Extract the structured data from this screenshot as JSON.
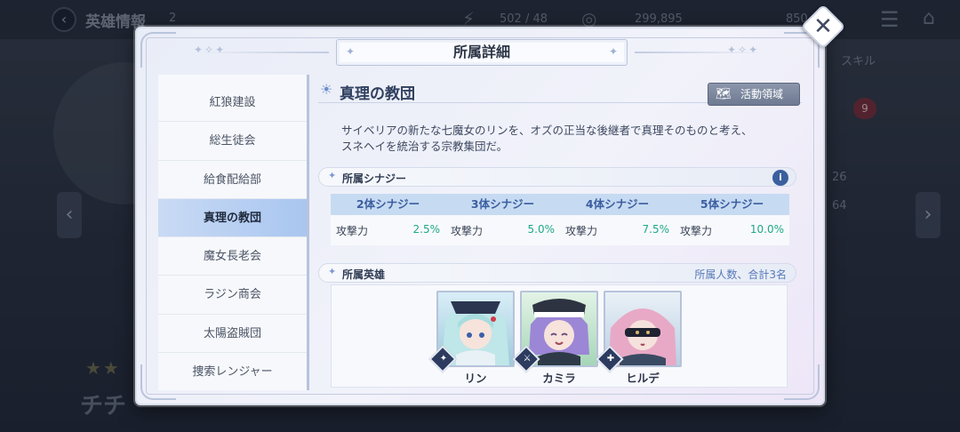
{
  "background": {
    "title": "英雄情報",
    "title_badge": "2",
    "stat_stamina": "502 / 48",
    "stat_gold": "299,895",
    "stat_gems": "850",
    "tab_skill": "スキル",
    "badge_count": "9",
    "side_value_1": "26",
    "side_value_2": "64",
    "hero_name": "チチ"
  },
  "modal": {
    "title": "所属詳細",
    "close_label": "✕"
  },
  "sidebar": {
    "items": [
      {
        "label": "紅狼建設"
      },
      {
        "label": "総生徒会"
      },
      {
        "label": "給食配給部"
      },
      {
        "label": "真理の教団"
      },
      {
        "label": "魔女長老会"
      },
      {
        "label": "ラジン商会"
      },
      {
        "label": "太陽盗賊団"
      },
      {
        "label": "捜索レンジャー"
      }
    ],
    "active_index": 3
  },
  "faction": {
    "name": "真理の教団",
    "area_button_label": "活動領域",
    "description_line1": "サイベリアの新たな七魔女のリンを、オズの正当な後継者で真理そのものと考え、",
    "description_line2": "スネヘイを統治する宗教集団だ。"
  },
  "synergy": {
    "section_label": "所属シナジー",
    "info_label": "i",
    "tiers": [
      {
        "header": "2体シナジー",
        "stat": "攻撃力",
        "value": "2.5%"
      },
      {
        "header": "3体シナジー",
        "stat": "攻撃力",
        "value": "5.0%"
      },
      {
        "header": "4体シナジー",
        "stat": "攻撃力",
        "value": "7.5%"
      },
      {
        "header": "5体シナジー",
        "stat": "攻撃力",
        "value": "10.0%"
      }
    ]
  },
  "heroes": {
    "section_label": "所属英雄",
    "count_text": "所属人数、合計3名",
    "list": [
      {
        "name": "リン"
      },
      {
        "name": "カミラ"
      },
      {
        "name": "ヒルデ"
      }
    ]
  },
  "colors": {
    "accent_blue": "#3c5ea0",
    "synergy_value": "#1fa88a",
    "active_tab": "#a9c6f0"
  }
}
